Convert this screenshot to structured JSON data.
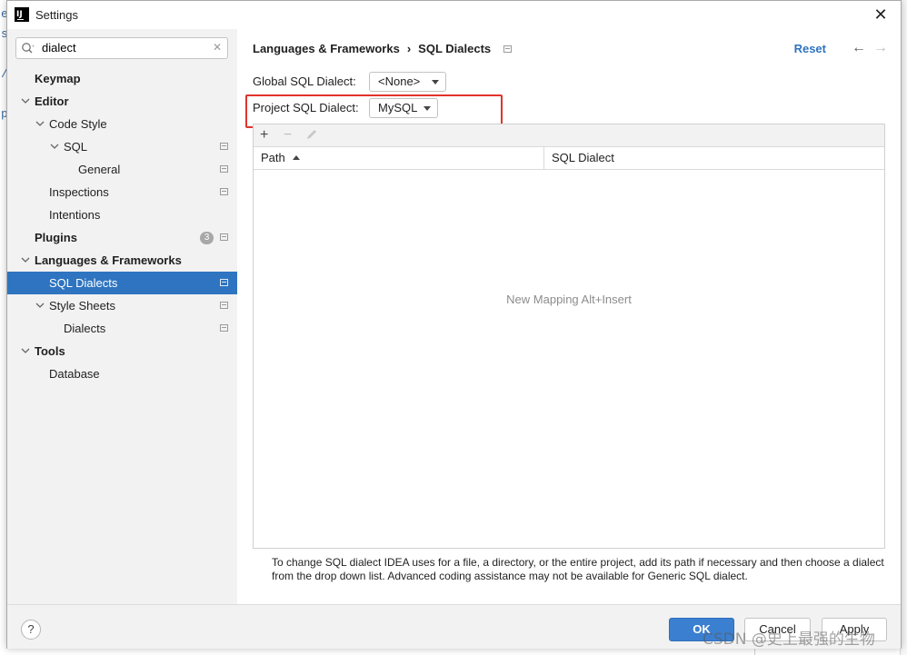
{
  "background": {
    "left_chars": [
      "e",
      "s",
      "/",
      "p"
    ]
  },
  "window": {
    "title": "Settings",
    "logo_text": "IJ"
  },
  "sidebar": {
    "search": {
      "value": "dialect"
    },
    "badge_count": "3",
    "items": [
      {
        "label": "Keymap"
      },
      {
        "label": "Editor"
      },
      {
        "label": "Code Style"
      },
      {
        "label": "SQL"
      },
      {
        "label": "General"
      },
      {
        "label": "Inspections"
      },
      {
        "label": "Intentions"
      },
      {
        "label": "Plugins"
      },
      {
        "label": "Languages & Frameworks"
      },
      {
        "label": "SQL Dialects"
      },
      {
        "label": "Style Sheets"
      },
      {
        "label": "Dialects"
      },
      {
        "label": "Tools"
      },
      {
        "label": "Database"
      }
    ]
  },
  "header": {
    "breadcrumb_parent": "Languages & Frameworks",
    "breadcrumb_separator": "›",
    "breadcrumb_current": "SQL Dialects",
    "reset_label": "Reset"
  },
  "form": {
    "global_label": "Global SQL Dialect:",
    "global_value": "<None>",
    "project_label": "Project SQL Dialect:",
    "project_value": "MySQL"
  },
  "table": {
    "toolbar": {
      "add": "+",
      "remove": "−"
    },
    "columns": [
      "Path",
      "SQL Dialect"
    ],
    "empty_text": "New Mapping Alt+Insert"
  },
  "help_text": "To change SQL dialect IDEA uses for a file, a directory, or the entire project, add its path if necessary and then choose a dialect from the drop down list. Advanced coding assistance may not be available for Generic SQL dialect.",
  "footer": {
    "help_label": "?",
    "ok_label": "OK",
    "cancel_label": "Cancel",
    "apply_label": "Apply"
  },
  "watermark": "CSDN @史上最强的生物",
  "colors": {
    "accent": "#2f74c0",
    "highlight_border": "#e0332d",
    "ok_button": "#3b7fd0"
  }
}
